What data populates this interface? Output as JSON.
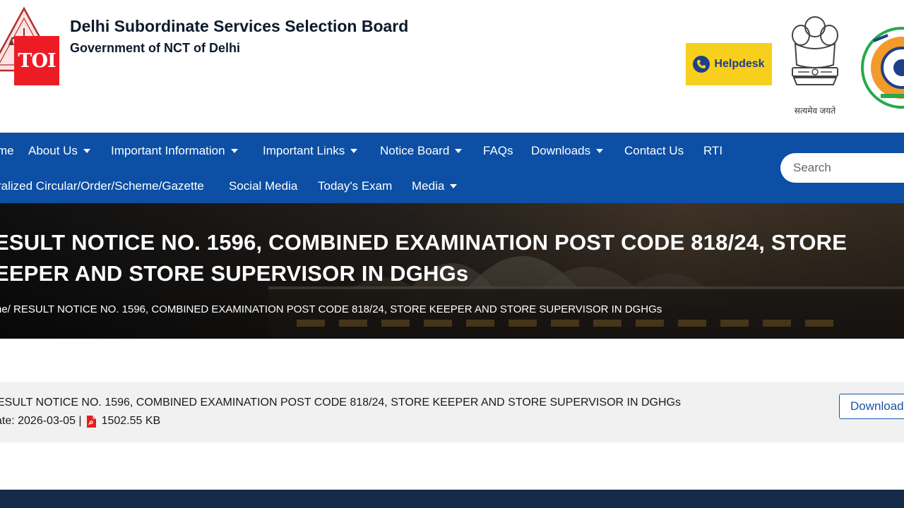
{
  "header": {
    "org_title": "Delhi Subordinate Services Selection Board",
    "org_subtitle": "Government of NCT of Delhi",
    "badge_text": "TOI",
    "helpdesk_label": "Helpdesk",
    "emblem_motto": "सत्यमेव जयते",
    "logo_icon": "dsssb-logo-icon",
    "cyber_logo_icon": "cyber-dost-logo-icon"
  },
  "nav": {
    "row1": [
      {
        "label": "me",
        "dropdown": false
      },
      {
        "label": "About Us",
        "dropdown": true
      },
      {
        "label": "Important Information",
        "dropdown": true
      },
      {
        "label": "Important Links",
        "dropdown": true
      },
      {
        "label": "Notice Board",
        "dropdown": true
      },
      {
        "label": "FAQs",
        "dropdown": false
      },
      {
        "label": "Downloads",
        "dropdown": true
      },
      {
        "label": "Contact Us",
        "dropdown": false
      },
      {
        "label": "RTI",
        "dropdown": false
      }
    ],
    "row2": [
      {
        "label": "ralized Circular/Order/Scheme/Gazette",
        "dropdown": false
      },
      {
        "label": "Social Media",
        "dropdown": false
      },
      {
        "label": "Today's Exam",
        "dropdown": false
      },
      {
        "label": "Media",
        "dropdown": true
      }
    ],
    "search_placeholder": "Search"
  },
  "hero": {
    "title_line1": "ESULT NOTICE NO. 1596, COMBINED EXAMINATION POST CODE 818/24, STORE",
    "title_line2": "EEPER AND STORE SUPERVISOR IN DGHGs",
    "breadcrumb": "ne/ RESULT NOTICE NO. 1596, COMBINED EXAMINATION POST CODE 818/24, STORE KEEPER AND STORE SUPERVISOR IN DGHGs"
  },
  "notice": {
    "title": "ESULT NOTICE NO. 1596, COMBINED EXAMINATION POST CODE 818/24, STORE KEEPER AND STORE SUPERVISOR IN DGHGs",
    "date_text": "ate: 2026-03-05 |",
    "file_size": "1502.55 KB",
    "file_icon": "pdf-icon",
    "download_label": "Download"
  },
  "colors": {
    "nav_bg": "#0c4fa4",
    "helpdesk_bg": "#f8cf1c",
    "badge_bg": "#ed1c24",
    "footer_bg": "#142a48",
    "download_border": "#1a55a6"
  }
}
